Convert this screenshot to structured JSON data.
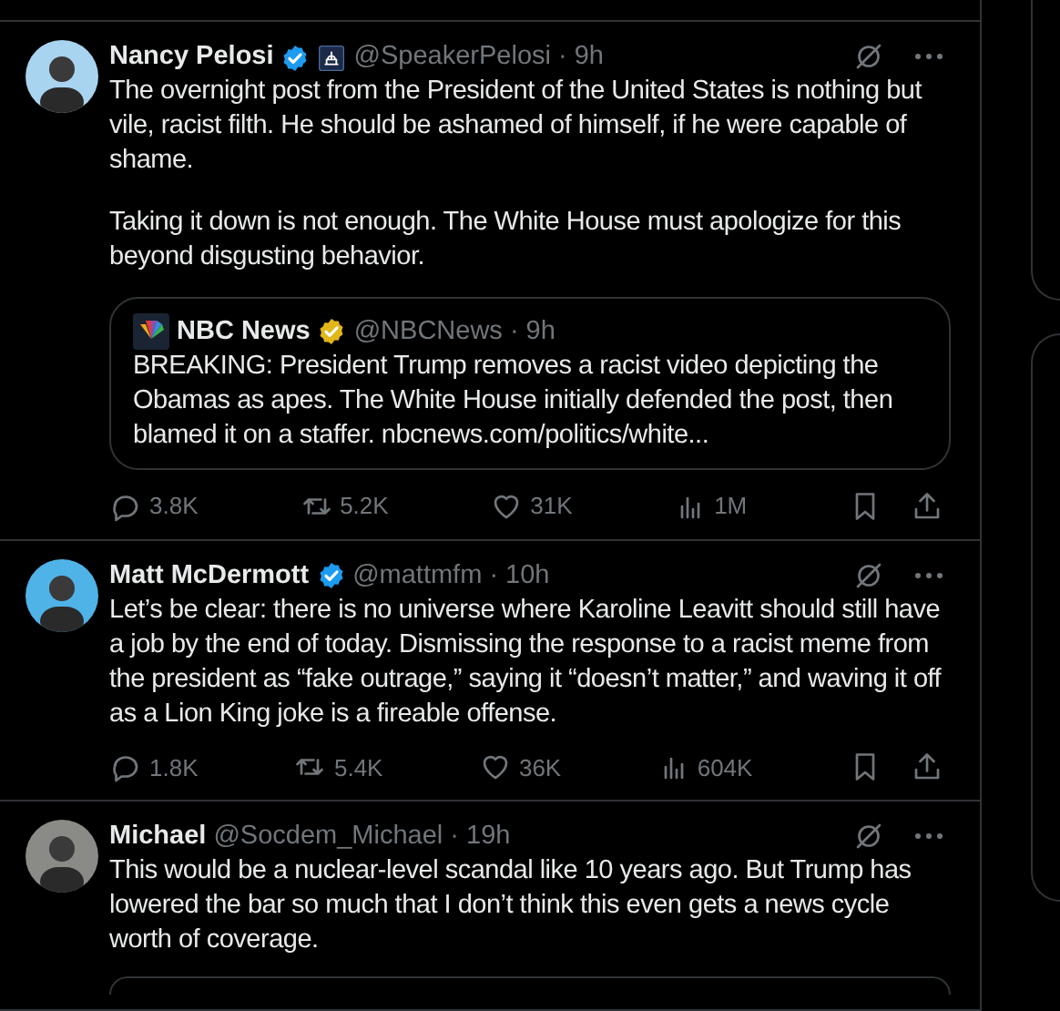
{
  "posts": [
    {
      "name": "Nancy Pelosi",
      "badge": {
        "color": "#1d9bf0"
      },
      "affiliate": true,
      "meta": "@SpeakerPelosi · 9h",
      "paragraphs": [
        "The overnight post from the President of the United States is nothing but vile, racist filth. He should be ashamed of himself, if he were capable of shame.",
        "Taking it down is not enough. The White House must apologize for this beyond disgusting behavior."
      ],
      "quote": {
        "name": "NBC News",
        "badge": {
          "color": "#e2b719"
        },
        "meta": "@NBCNews · 9h",
        "text": "BREAKING: President Trump removes a racist video depicting the Obamas as apes. The White House initially defended the post, then blamed it on a staffer. nbcnews.com/politics/white..."
      },
      "stats": {
        "replies": "3.8K",
        "reposts": "5.2K",
        "likes": "31K",
        "views": "1M"
      }
    },
    {
      "name": "Matt McDermott",
      "badge": {
        "color": "#1d9bf0"
      },
      "meta": "@mattmfm · 10h",
      "paragraphs": [
        "Let’s be clear: there is no universe where Karoline Leavitt should still have a job by the end of today. Dismissing the response to a racist meme from the president as “fake outrage,” saying it “doesn’t matter,” and waving it off as a Lion King joke is a fireable offense."
      ],
      "stats": {
        "replies": "1.8K",
        "reposts": "5.4K",
        "likes": "36K",
        "views": "604K"
      }
    },
    {
      "name": "Michael",
      "meta": "@Socdem_Michael · 19h",
      "paragraphs": [
        "This would be a nuclear-level scandal like 10 years ago. But Trump has lowered the bar so much that I don’t think this even gets a news cycle worth of coverage."
      ],
      "quote_card_cut": true
    }
  ]
}
